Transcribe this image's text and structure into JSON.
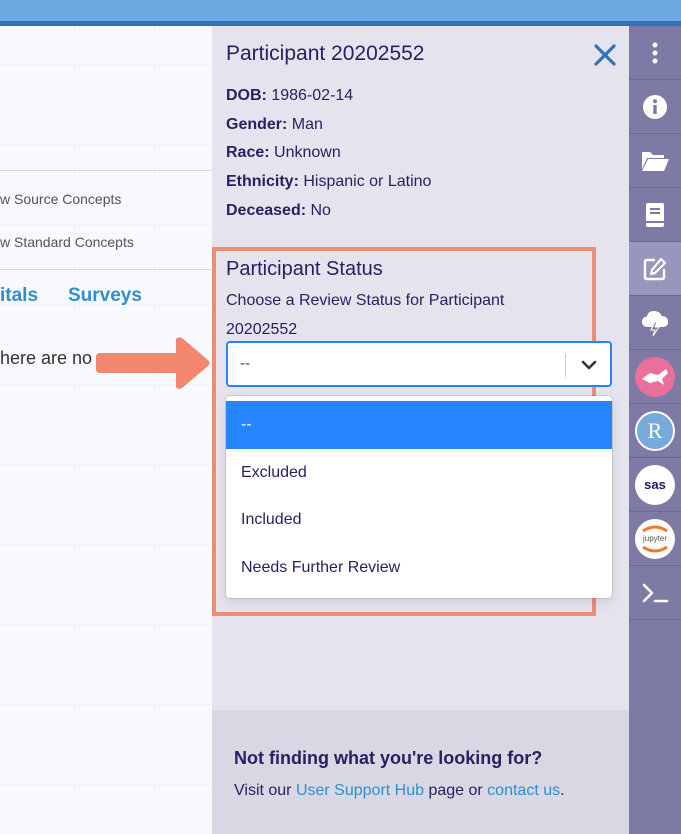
{
  "background": {
    "concept_options": [
      "w Source Concepts",
      "w Standard Concepts"
    ],
    "tabs": [
      "itals",
      "Surveys"
    ],
    "empty_text": "here are no"
  },
  "panel": {
    "title": "Participant 20202552",
    "fields": [
      {
        "label": "DOB:",
        "value": "1986-02-14"
      },
      {
        "label": "Gender:",
        "value": "Man"
      },
      {
        "label": "Race:",
        "value": "Unknown"
      },
      {
        "label": "Ethnicity:",
        "value": "Hispanic or Latino"
      },
      {
        "label": "Deceased:",
        "value": "No"
      }
    ],
    "status": {
      "title": "Participant Status",
      "subtitle": "Choose a Review Status for Participant 20202552",
      "selected_value": "--",
      "options": [
        "--",
        "Excluded",
        "Included",
        "Needs Further Review"
      ]
    },
    "help": {
      "title": "Not finding what you're looking for?",
      "text_prefix": "Visit our ",
      "link1": "User Support Hub",
      "text_middle": " page or ",
      "link2": "contact us",
      "text_suffix": "."
    }
  },
  "rail": {
    "items": [
      "more-vertical-icon",
      "info-icon",
      "folder-open-icon",
      "book-icon",
      "edit-icon",
      "cloud-lightning-icon",
      "cromwell-icon",
      "r-icon",
      "sas-icon",
      "jupyter-icon",
      "terminal-icon"
    ],
    "r_label": "R",
    "sas_label": "sas",
    "jupyter_label": "jupyter"
  },
  "colors": {
    "accent": "#2684ff",
    "highlight_border": "#f08b74",
    "navy": "#262262",
    "link": "#2f8fd0"
  }
}
